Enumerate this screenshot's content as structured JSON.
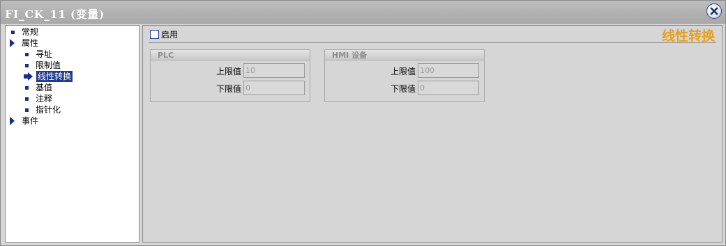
{
  "window": {
    "title": "FI_CK_11 (变量)",
    "close_icon": "close-icon"
  },
  "tree": {
    "items": [
      {
        "label": "常规",
        "level": 0,
        "marker": "square-bullet"
      },
      {
        "label": "属性",
        "level": 0,
        "marker": "expand-triangle"
      },
      {
        "label": "寻址",
        "level": 1,
        "marker": "square-bullet"
      },
      {
        "label": "限制值",
        "level": 1,
        "marker": "square-bullet"
      },
      {
        "label": "线性转换",
        "level": 1,
        "marker": "selected-arrow",
        "selected": true
      },
      {
        "label": "基值",
        "level": 1,
        "marker": "square-bullet"
      },
      {
        "label": "注释",
        "level": 1,
        "marker": "square-bullet"
      },
      {
        "label": "指针化",
        "level": 1,
        "marker": "square-bullet"
      },
      {
        "label": "事件",
        "level": 0,
        "marker": "expand-triangle"
      }
    ]
  },
  "content": {
    "enable_label": "启用",
    "enable_checked": false,
    "section_title": "线性转换",
    "accent_color": "#e8a020",
    "plc": {
      "header": "PLC",
      "upper_label": "上限值",
      "upper_value": "10",
      "lower_label": "下限值",
      "lower_value": "0"
    },
    "hmi": {
      "header": "HMI 设备",
      "upper_label": "上限值",
      "upper_value": "100",
      "lower_label": "下限值",
      "lower_value": "0"
    }
  }
}
